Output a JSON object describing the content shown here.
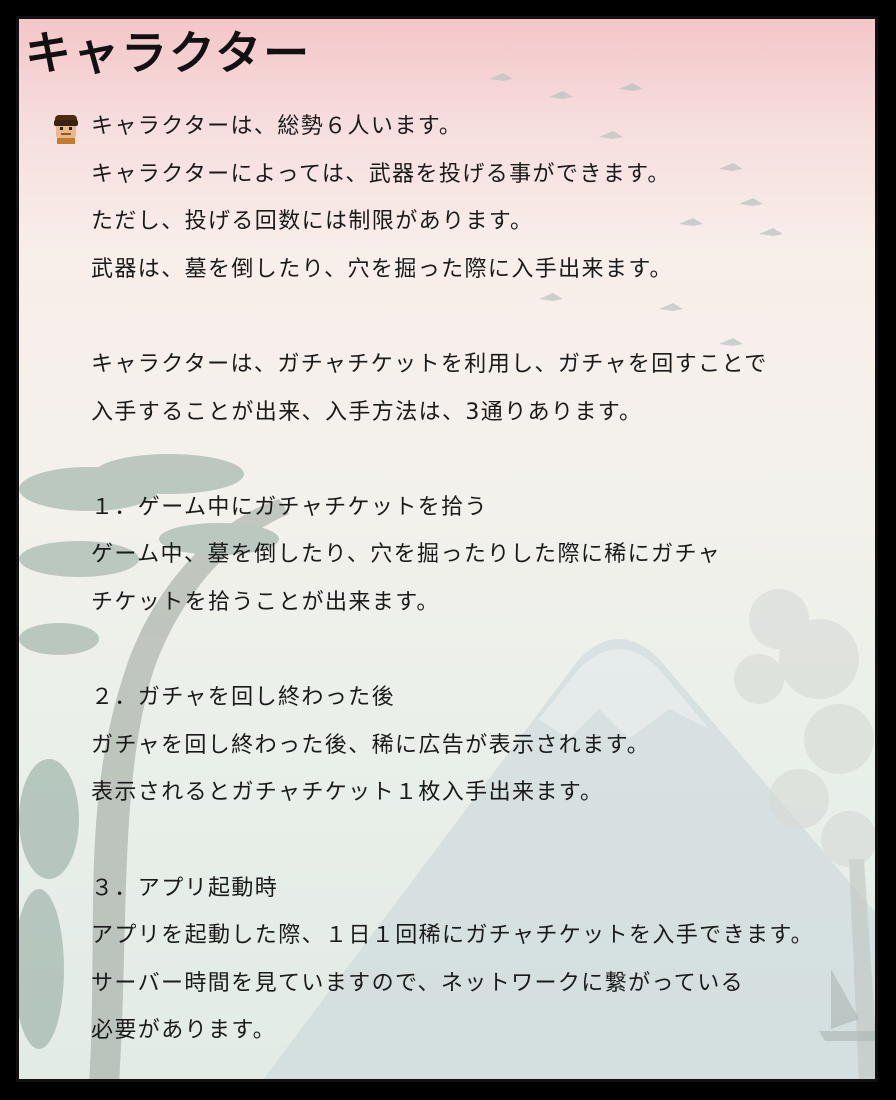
{
  "page": {
    "title": "キャラクター",
    "avatar_icon": "character-face-icon"
  },
  "lines": [
    "キャラクターは、総勢６人います。",
    "キャラクターによっては、武器を投げる事ができます。",
    "ただし、投げる回数には制限があります。",
    "武器は、墓を倒したり、穴を掘った際に入手出来ます。",
    "",
    "キャラクターは、ガチャチケットを利用し、ガチャを回すことで",
    "入手することが出来、入手方法は、3通りあります。",
    "",
    "１．ゲーム中にガチャチケットを拾う",
    "ゲーム中、墓を倒したり、穴を掘ったりした際に稀にガチャ",
    "チケットを拾うことが出来ます。",
    "",
    "２．ガチャを回し終わった後",
    "ガチャを回し終わった後、稀に広告が表示されます。",
    "表示されるとガチャチケット１枚入手出来ます。",
    "",
    "３．アプリ起動時",
    "アプリを起動した際、１日１回稀にガチャチケットを入手できます。",
    "サーバー時間を見ていますので、ネットワークに繋がっている",
    "必要があります。"
  ]
}
